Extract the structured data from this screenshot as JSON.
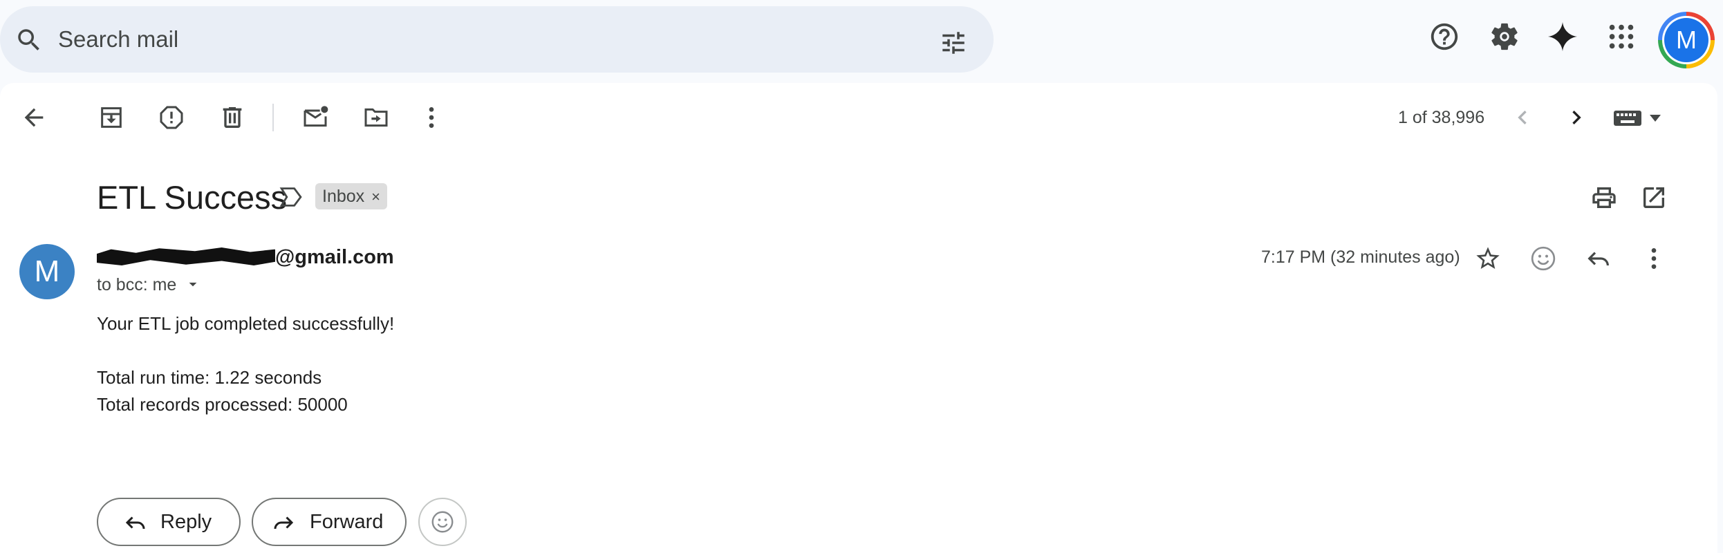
{
  "search": {
    "placeholder": "Search mail"
  },
  "toolbar": {
    "pager": "1 of 38,996"
  },
  "message": {
    "subject": "ETL Success",
    "label_chip": "Inbox",
    "label_remove": "×",
    "sender_initial": "M",
    "sender_visible": "@gmail.com",
    "recipients": "to bcc: me",
    "time": "7:17 PM (32 minutes ago)",
    "body": [
      "Your ETL job completed successfully!",
      "Total run time: 1.22 seconds",
      "Total records processed: 50000"
    ]
  },
  "actions": {
    "reply_label": "Reply",
    "forward_label": "Forward"
  },
  "account": {
    "initial": "M"
  },
  "colors": {
    "avatar_blue": "#1a73e8",
    "sender_avatar": "#3b82c4",
    "search_bg": "#e9eef6",
    "page_bg": "#f8fafd"
  }
}
